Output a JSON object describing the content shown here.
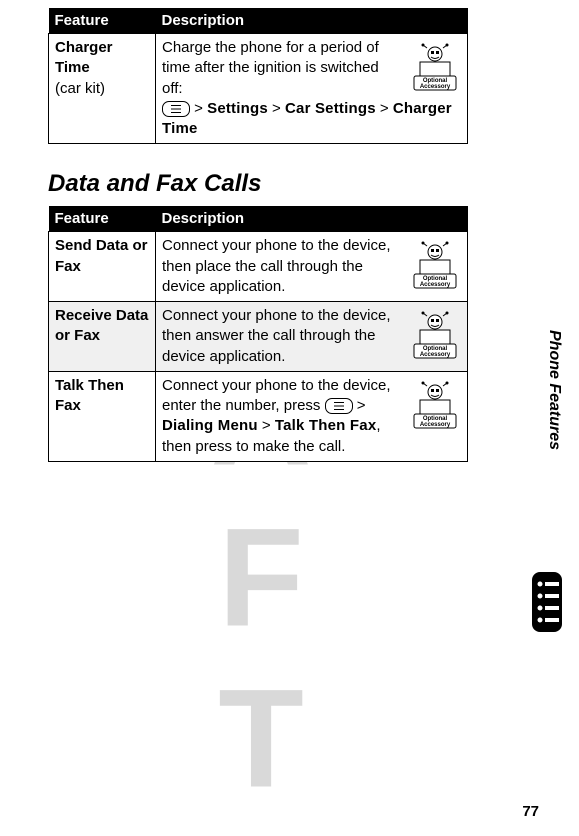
{
  "watermark": "DRAFT",
  "table1": {
    "headers": {
      "feature": "Feature",
      "description": "Description"
    },
    "rows": [
      {
        "feature_bold": "Charger Time",
        "feature_plain": "(car kit)",
        "desc_lead": "Charge the phone for a period of time after the ignition is switched off:",
        "path_parts": {
          "p1": "Settings",
          "p2": "Car Settings",
          "p3": "Charger Time"
        },
        "accessory_top": "Optional",
        "accessory_bottom": "Accessory"
      }
    ]
  },
  "section_title": "Data and Fax Calls",
  "table2": {
    "headers": {
      "feature": "Feature",
      "description": "Description"
    },
    "rows": [
      {
        "gray": false,
        "feature_bold": "Send Data or Fax",
        "desc": "Connect your phone to the device, then place the call through the device application.",
        "accessory_top": "Optional",
        "accessory_bottom": "Accessory"
      },
      {
        "gray": true,
        "feature_bold": "Receive Data or Fax",
        "desc": "Connect your phone to the device, then answer the call through the device application.",
        "accessory_top": "Optional",
        "accessory_bottom": "Accessory"
      },
      {
        "gray": false,
        "feature_bold": "Talk Then Fax",
        "desc_lead": "Connect your phone to the device, enter the number, press ",
        "path_parts": {
          "p1": "Dialing Menu",
          "p2": "Talk Then Fax"
        },
        "desc_trail": ", then press to make the call.",
        "accessory_top": "Optional",
        "accessory_bottom": "Accessory"
      }
    ]
  },
  "side_label": "Phone Features",
  "page_number": "77"
}
